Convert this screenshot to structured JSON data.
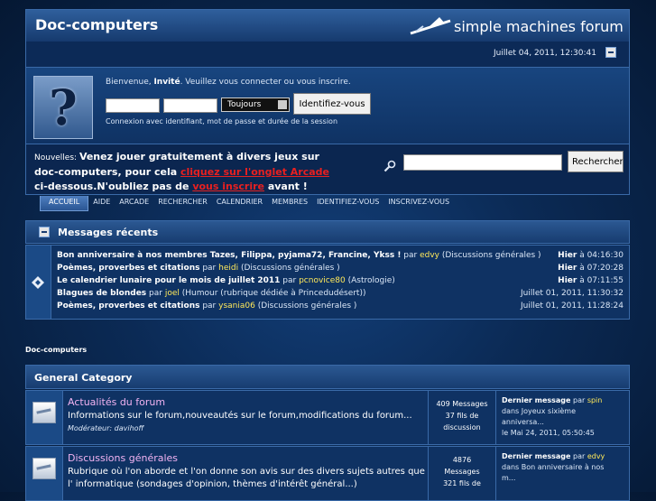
{
  "header": {
    "site_title": "Doc-computers",
    "brand": "simple machines forum",
    "date": "Juillet 04, 2011, 12:30:41"
  },
  "user": {
    "welcome_pre": "Bienvenue, ",
    "welcome_user": "Invité",
    "welcome_post": ". Veuillez vous connecter ou vous inscrire.",
    "duration_value": "Toujours",
    "login_label": "Identifiez-vous",
    "hint": "Connexion avec identifiant, mot de passe et durée de la session"
  },
  "news": {
    "label": "Nouvelles: ",
    "text1": "Venez jouer gratuitement à divers jeux sur doc-computers, pour cela ",
    "link1": "cliquez sur l'onglet Arcade",
    "text2": " ci-dessous.N'oubliez pas de ",
    "link2": "vous inscrire",
    "text3": " avant !",
    "search_label": "Rechercher"
  },
  "menu": {
    "items": [
      "ACCUEIL",
      "AIDE",
      "ARCADE",
      "RECHERCHER",
      "CALENDRIER",
      "MEMBRES",
      "IDENTIFIEZ-VOUS",
      "INSCRIVEZ-VOUS"
    ]
  },
  "recent": {
    "title": "Messages récents",
    "by": " par ",
    "posts": [
      {
        "title": "Bon anniversaire à nos membres Tazes, Filippa, pyjama72, Francine, Ykss !",
        "author": "edvy",
        "board": " (Discussions générales )",
        "day": "Hier",
        "time": " à 04:16:30"
      },
      {
        "title": "Poèmes, proverbes et citations",
        "author": "heidi",
        "board": " (Discussions générales )",
        "day": "Hier",
        "time": " à 07:20:28"
      },
      {
        "title": "Le calendrier lunaire pour le mois de juillet 2011",
        "author": "pcnovice80",
        "board": " (Astrologie)",
        "day": "Hier",
        "time": " à 07:11:55"
      },
      {
        "title": "Blagues de blondes",
        "author": "joel",
        "board": " (Humour (rubrique dédiée à Princedudésert))",
        "day": "",
        "time": "Juillet 01, 2011, 11:30:32"
      },
      {
        "title": "Poèmes, proverbes et citations",
        "author": "ysania06",
        "board": " (Discussions générales )",
        "day": "",
        "time": "Juillet 01, 2011, 11:28:24"
      }
    ]
  },
  "breadcrumb": "Doc-computers",
  "category": {
    "title": "General Category",
    "boards": [
      {
        "name": "Actualités du forum",
        "desc": "Informations sur le forum,nouveautés sur le forum,modifications du forum...",
        "mods_label": "Modérateur: ",
        "mods": "davihoff",
        "stats1": "409 Messages",
        "stats2": "37 fils de",
        "stats3": "discussion",
        "last_label": "Dernier message",
        "last_by": " par ",
        "last_author": "spin",
        "last_in": "dans Joyeux sixième",
        "last_in2": "anniversa...",
        "last_date": "le Mai 24, 2011, 05:50:45"
      },
      {
        "name": "Discussions générales",
        "desc": "Rubrique où l'on aborde et l'on donne son avis sur des divers sujets autres que l' informatique (sondages d'opinion, thèmes d'intérêt général...)",
        "stats1": "4876",
        "stats2": "Messages",
        "stats3": "321 fils de",
        "last_label": "Dernier message",
        "last_by": " par ",
        "last_author": "edvy",
        "last_in": "dans Bon anniversaire à nos",
        "last_in2": "m..."
      }
    ]
  }
}
